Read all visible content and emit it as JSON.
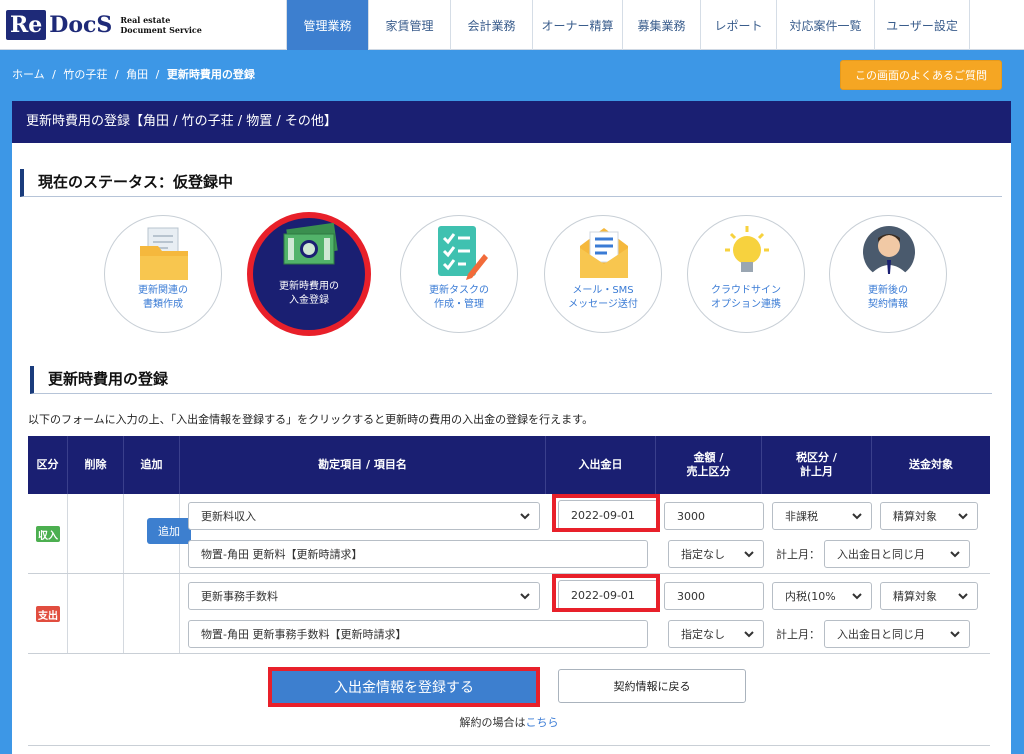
{
  "logo": {
    "re": "Re",
    "docs": "DocS",
    "sub1": "Real estate",
    "sub2": "Document Service"
  },
  "nav": [
    {
      "label": "管理業務",
      "active": true,
      "width": 82
    },
    {
      "label": "家賃管理",
      "active": false,
      "width": 82
    },
    {
      "label": "会計業務",
      "active": false,
      "width": 82
    },
    {
      "label": "オーナー精算",
      "active": false,
      "width": 90
    },
    {
      "label": "募集業務",
      "active": false,
      "width": 78
    },
    {
      "label": "レポート",
      "active": false,
      "width": 76
    },
    {
      "label": "対応案件一覧",
      "active": false,
      "width": 98
    },
    {
      "label": "ユーザー設定",
      "active": false,
      "width": 96
    }
  ],
  "breadcrumb": {
    "home": "ホーム",
    "sep": "/",
    "property": "竹の子荘",
    "owner": "角田",
    "current": "更新時費用の登録"
  },
  "faq_button": "この画面のよくあるご質問",
  "panel_title": "更新時費用の登録【角田 / 竹の子荘 / 物置 / その他】",
  "status_title": "現在のステータス：仮登録中",
  "steps": [
    {
      "line1": "更新関連の",
      "line2": "書類作成",
      "icon": "folder-document-icon"
    },
    {
      "line1": "更新時費用の",
      "line2": "入金登録",
      "icon": "money-icon"
    },
    {
      "line1": "更新タスクの",
      "line2": "作成・管理",
      "icon": "checklist-icon"
    },
    {
      "line1": "メール・SMS",
      "line2": "メッセージ送付",
      "icon": "mail-icon"
    },
    {
      "line1": "クラウドサイン",
      "line2": "オプション連携",
      "icon": "lightbulb-icon"
    },
    {
      "line1": "更新後の",
      "line2": "契約情報",
      "icon": "person-icon"
    }
  ],
  "reg_title": "更新時費用の登録",
  "note": "以下のフォームに入力の上、「入出金情報を登録する」をクリックすると更新時の費用の入出金の登録を行えます。",
  "table": {
    "headers": {
      "kubun": "区分",
      "delete": "削除",
      "add": "追加",
      "item": "勘定項目 / 項目名",
      "date": "入出金日",
      "amount1": "金額 /",
      "amount2": "売上区分",
      "tax1": "税区分 /",
      "tax2": "計上月",
      "target": "送金対象"
    },
    "rows": [
      {
        "badge": "収入",
        "type": "in",
        "add_label": "追加",
        "account": "更新料収入",
        "date": "2022-09-01",
        "amount": "3000",
        "tax": "非課税",
        "target": "精算対象",
        "name": "物置-角田 更新料【更新時請求】",
        "sales": "指定なし",
        "month_label": "計上月：",
        "month": "入出金日と同じ月"
      },
      {
        "badge": "支出",
        "type": "out",
        "add_label": "",
        "account": "更新事務手数料",
        "date": "2022-09-01",
        "amount": "3000",
        "tax": "内税(10%",
        "target": "精算対象",
        "name": "物置-角田 更新事務手数料【更新時請求】",
        "sales": "指定なし",
        "month_label": "計上月：",
        "month": "入出金日と同じ月"
      }
    ]
  },
  "submit_button": "入出金情報を登録する",
  "back_button": "契約情報に戻る",
  "cancel_text": "解約の場合は",
  "cancel_link": "こちら",
  "colors": {
    "navy": "#1a1f72",
    "blue": "#3d7fcf",
    "sky": "#3d97e6",
    "orange": "#f5a623",
    "red": "#e8202a",
    "green": "#4caf50"
  }
}
